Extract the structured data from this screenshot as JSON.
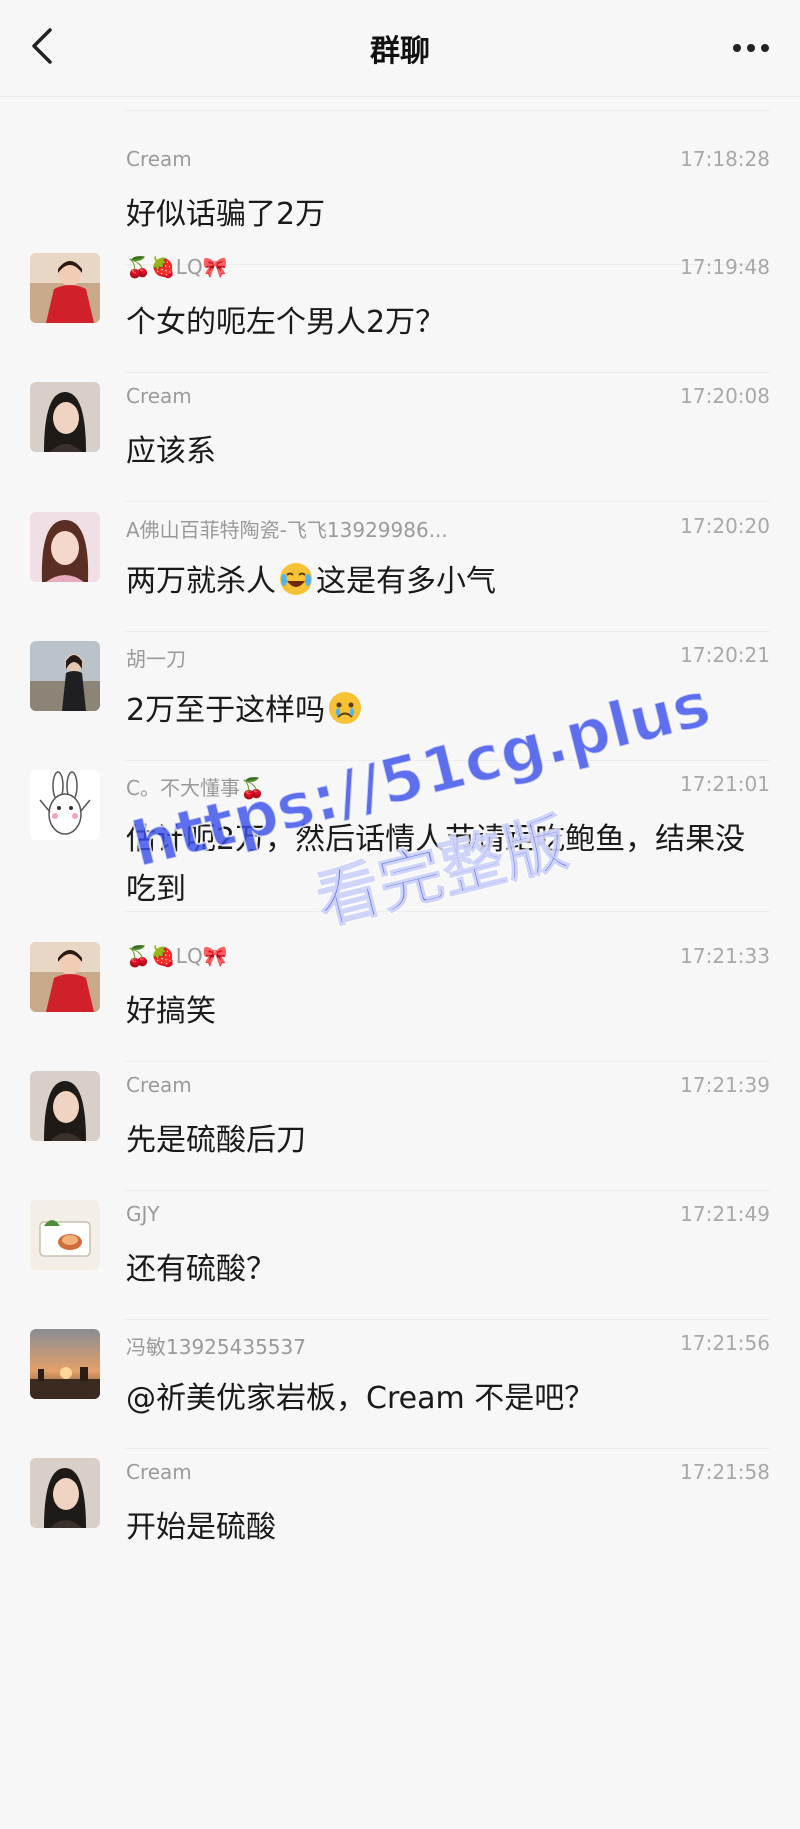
{
  "header": {
    "title": "群聊",
    "back_icon": "chevron-left-icon",
    "more_icon": "more-dots-icon"
  },
  "messages": [
    {
      "sender": "Cream",
      "time": "17:18:28",
      "text": "好似话骗了2万",
      "avatar": "none"
    },
    {
      "sender": "🍒🍓LQ🎀",
      "time": "17:19:48",
      "text": "个女的呃左个男人2万？",
      "avatar": "girl-red-dress"
    },
    {
      "sender": "Cream",
      "time": "17:20:08",
      "text": "应该系",
      "avatar": "woman-dark-hair"
    },
    {
      "sender": "A佛山百菲特陶瓷-飞飞13929986...",
      "time": "17:20:20",
      "text_before": "两万就杀人",
      "emoji": "laughing-crying-emoji",
      "text_after": "这是有多小气",
      "avatar": "woman-pink"
    },
    {
      "sender": "胡一刀",
      "time": "17:20:21",
      "text_before": "2万至于这样吗",
      "emoji": "crying-emoji",
      "text_after": "",
      "avatar": "woman-outdoor"
    },
    {
      "sender": "C。不大懂事🍒",
      "time": "17:21:01",
      "text": "估计呃2万，然后话情人节请距吃鲍鱼，结果没吃到",
      "avatar": "cartoon-rabbit"
    },
    {
      "sender": "🍒🍓LQ🎀",
      "time": "17:21:33",
      "text": "好搞笑",
      "avatar": "girl-red-dress"
    },
    {
      "sender": "Cream",
      "time": "17:21:39",
      "text": "先是硫酸后刀",
      "avatar": "woman-dark-hair"
    },
    {
      "sender": "GJY",
      "time": "17:21:49",
      "text": "还有硫酸？",
      "avatar": "cartoon-card"
    },
    {
      "sender": "冯敏13925435537",
      "time": "17:21:56",
      "text": "@祈美优家岩板，Cream 不是吧？",
      "avatar": "sunset"
    },
    {
      "sender": "Cream",
      "time": "17:21:58",
      "text": "开始是硫酸",
      "avatar": "woman-dark-hair"
    }
  ],
  "watermark": {
    "line1": "https://51cg.plus",
    "line2": "看完整版",
    "color": "#3c50eb"
  }
}
